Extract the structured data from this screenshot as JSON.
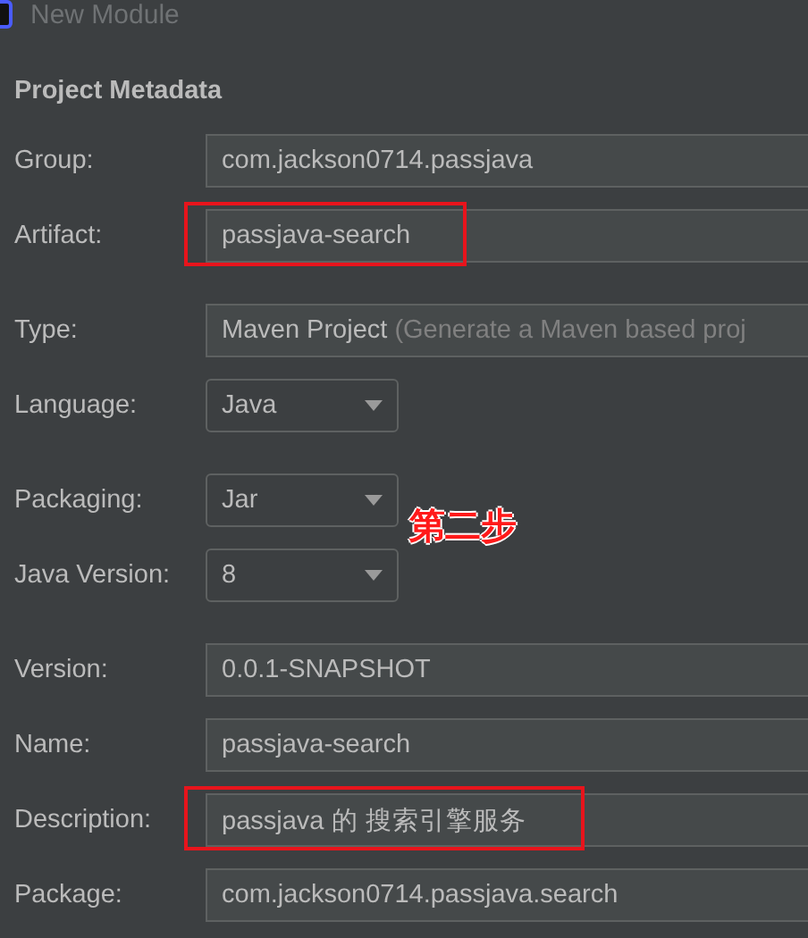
{
  "window": {
    "title": "New Module"
  },
  "section_title": "Project Metadata",
  "sections": [
    [
      {
        "label": "Group:",
        "kind": "text",
        "value": "com.jackson0714.passjava",
        "highlighted": false
      },
      {
        "label": "Artifact:",
        "kind": "text",
        "value": "passjava-search",
        "highlighted": true
      }
    ],
    [
      {
        "label": "Type:",
        "kind": "type",
        "value": "Maven Project",
        "hint": "(Generate a Maven based proj",
        "highlighted": false
      },
      {
        "label": "Language:",
        "kind": "dropdown",
        "value": "Java",
        "highlighted": false
      }
    ],
    [
      {
        "label": "Packaging:",
        "kind": "dropdown",
        "value": "Jar",
        "highlighted": false,
        "annotation": "第二步"
      },
      {
        "label": "Java Version:",
        "kind": "dropdown",
        "value": "8",
        "highlighted": false
      }
    ],
    [
      {
        "label": "Version:",
        "kind": "text",
        "value": "0.0.1-SNAPSHOT",
        "highlighted": false
      },
      {
        "label": "Name:",
        "kind": "text",
        "value": "passjava-search",
        "highlighted": false
      },
      {
        "label": "Description:",
        "kind": "text",
        "value": "passjava 的 搜索引擎服务",
        "highlighted": true
      },
      {
        "label": "Package:",
        "kind": "text",
        "value": "com.jackson0714.passjava.search",
        "highlighted": false
      }
    ]
  ]
}
